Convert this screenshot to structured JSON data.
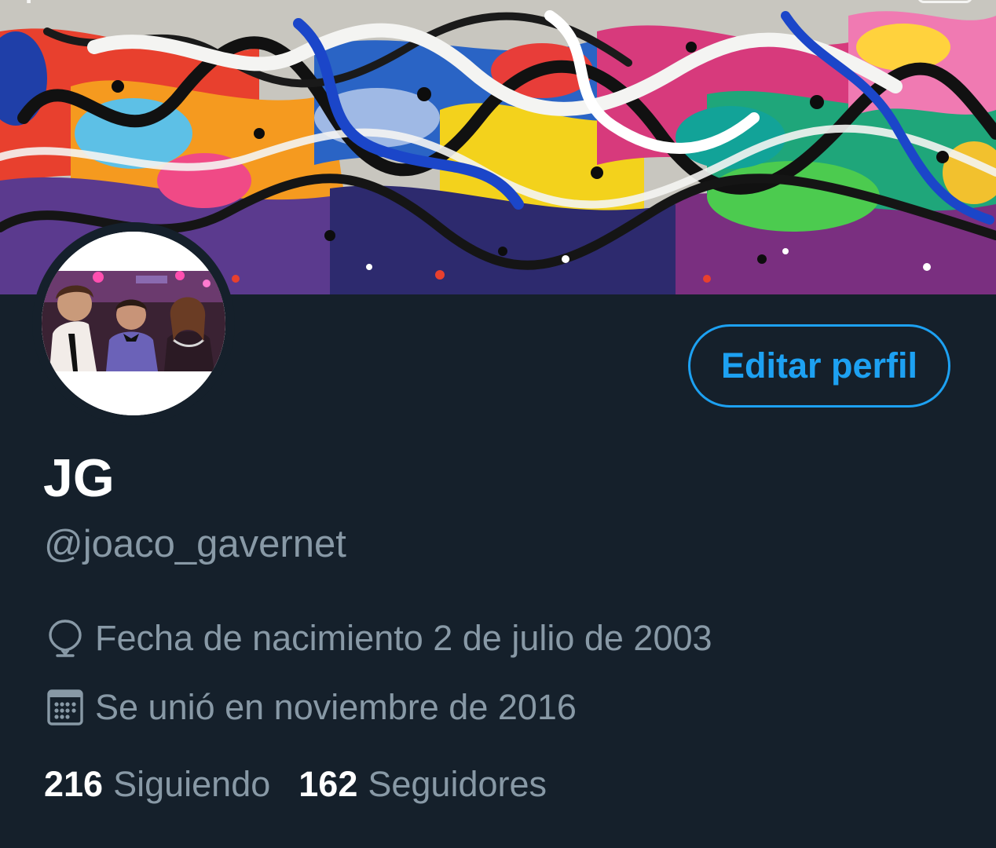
{
  "profile": {
    "display_name": "JG",
    "handle": "@joaco_gavernet",
    "edit_button_label": "Editar perfil",
    "birth_date": "Fecha de nacimiento 2 de julio de 2003",
    "joined": "Se unió en noviembre de 2016"
  },
  "stats": {
    "following_count": "216",
    "following_label": "Siguiendo",
    "followers_count": "162",
    "followers_label": "Seguidores"
  },
  "icons": {
    "birth": "balloon-icon",
    "joined": "calendar-icon"
  },
  "colors": {
    "background": "#15202b",
    "accent": "#1da1f2",
    "secondary_text": "#8899a6",
    "primary_text": "#ffffff"
  }
}
